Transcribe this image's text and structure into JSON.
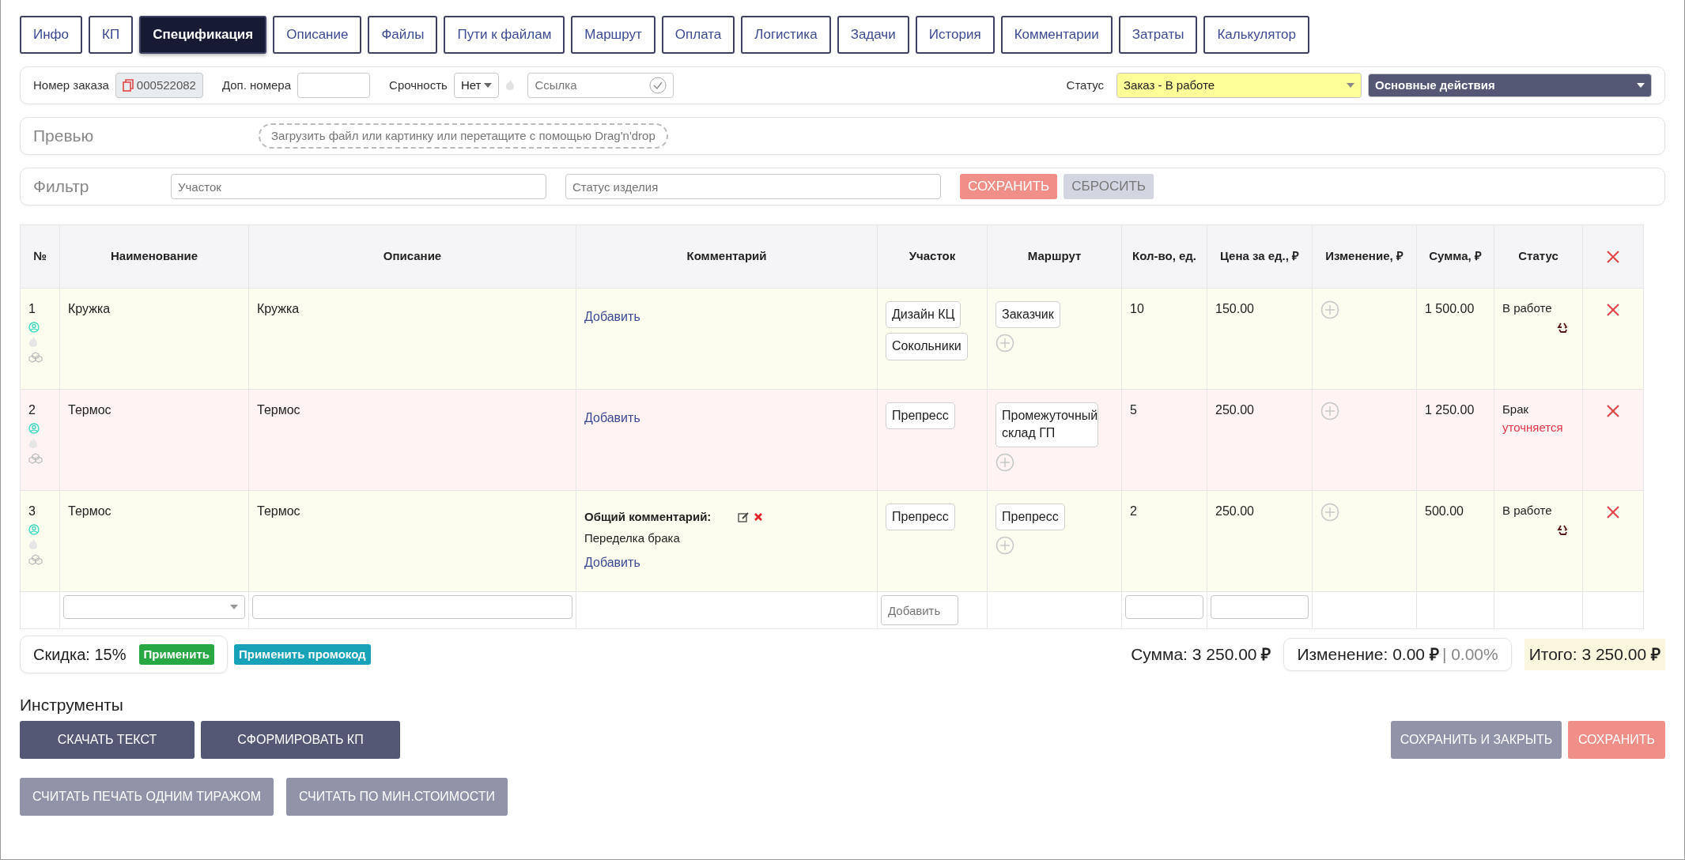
{
  "tabs": [
    {
      "label": "Инфо",
      "selected": false
    },
    {
      "label": "КП",
      "selected": false
    },
    {
      "label": "Спецификация",
      "selected": true
    },
    {
      "label": "Описание",
      "selected": false
    },
    {
      "label": "Файлы",
      "selected": false
    },
    {
      "label": "Пути к файлам",
      "selected": false
    },
    {
      "label": "Маршрут",
      "selected": false
    },
    {
      "label": "Оплата",
      "selected": false
    },
    {
      "label": "Логистика",
      "selected": false
    },
    {
      "label": "Задачи",
      "selected": false
    },
    {
      "label": "История",
      "selected": false
    },
    {
      "label": "Комментарии",
      "selected": false
    },
    {
      "label": "Затраты",
      "selected": false
    },
    {
      "label": "Калькулятор",
      "selected": false
    }
  ],
  "order_bar": {
    "number_label": "Номер заказа",
    "number": "000522082",
    "extra_label": "Доп. номера",
    "urgency_label": "Срочность",
    "urgency": "Нет",
    "link_placeholder": "Ссылка",
    "status_label": "Статус",
    "status": "Заказ - В работе",
    "actions": "Основные действия"
  },
  "preview": {
    "title": "Превью",
    "dropzone": "Загрузить файл или картинку или перетащите с помощью Drag'n'drop"
  },
  "filter": {
    "title": "Фильтр",
    "area_placeholder": "Участок",
    "status_placeholder": "Статус изделия",
    "save": "СОХРАНИТЬ",
    "reset": "СБРОСИТЬ"
  },
  "table": {
    "columns": [
      "№",
      "Наименование",
      "Описание",
      "Комментарий",
      "Участок",
      "Маршрут",
      "Кол-во, ед.",
      "Цена за ед., ₽",
      "Изменение, ₽",
      "Сумма, ₽",
      "Статус"
    ],
    "rows": [
      {
        "number": "1",
        "name": "Кружка",
        "description": "Кружка",
        "kind": "work",
        "comment": null,
        "add_comment": "Добавить",
        "areas": [
          "Дизайн КЦ",
          "Сокольники"
        ],
        "route": [
          "Заказчик"
        ],
        "qty": "10",
        "price": "150.00",
        "sum": "1 500.00",
        "status": "В работе",
        "status_note": null
      },
      {
        "number": "2",
        "name": "Термос",
        "description": "Термос",
        "kind": "defect",
        "comment": null,
        "add_comment": "Добавить",
        "areas": [
          "Препресс"
        ],
        "route": [
          "Промежуточный склад ГП"
        ],
        "qty": "5",
        "price": "250.00",
        "sum": "1 250.00",
        "status": "Брак",
        "status_note": "уточняется"
      },
      {
        "number": "3",
        "name": "Термос",
        "description": "Термос",
        "kind": "work",
        "comment": {
          "label": "Общий комментарий:",
          "text": "Переделка брака"
        },
        "add_comment": "Добавить",
        "areas": [
          "Препресс"
        ],
        "route": [
          "Препресс"
        ],
        "qty": "2",
        "price": "250.00",
        "sum": "500.00",
        "status": "В работе",
        "status_note": null
      }
    ],
    "new_row": {
      "area_placeholder": "Добавить"
    }
  },
  "totals": {
    "discount": "Скидка: 15%",
    "apply": "Применить",
    "promo": "Применить промокод",
    "sum": "Сумма: 3 250.00 **₽**",
    "change": "Изменение: 0.00 **₽**",
    "change_percent": "| 0.00%",
    "total": "Итого: 3 250.00 **₽**"
  },
  "tools": {
    "title": "Инструменты",
    "primary": [
      "СКАЧАТЬ ТЕКСТ",
      "СФОРМИРОВАТЬ КП"
    ],
    "secondary": [
      "СЧИТАТЬ ПЕЧАТЬ ОДНИМ ТИРАЖОМ",
      "СЧИТАТЬ ПО МИН.СТОИМОСТИ"
    ],
    "save_close": "СОХРАНИТЬ И ЗАКРЫТЬ",
    "save": "СОХРАНИТЬ"
  }
}
